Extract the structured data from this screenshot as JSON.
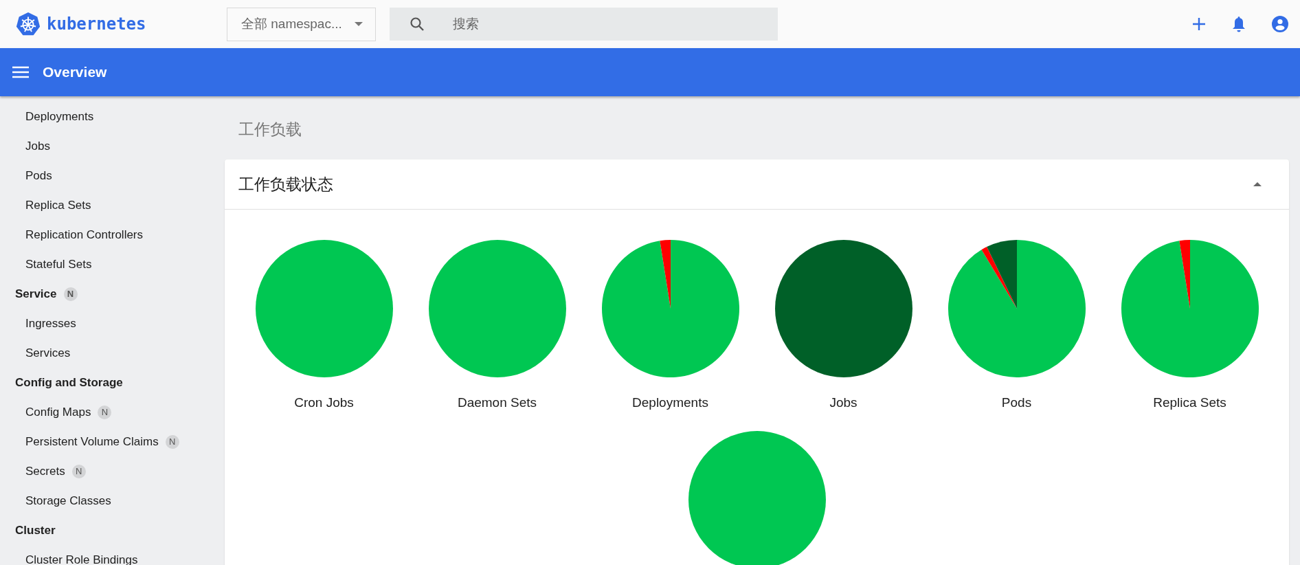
{
  "topbar": {
    "logo": "kubernetes",
    "namespace": "全部 namespac...",
    "search": {
      "placeholder": "搜索"
    }
  },
  "titlebar": {
    "title": "Overview"
  },
  "sidebar": {
    "items": [
      {
        "kind": "item",
        "label": "Deployments"
      },
      {
        "kind": "item",
        "label": "Jobs"
      },
      {
        "kind": "item",
        "label": "Pods"
      },
      {
        "kind": "item",
        "label": "Replica Sets"
      },
      {
        "kind": "item",
        "label": "Replication Controllers"
      },
      {
        "kind": "item",
        "label": "Stateful Sets"
      },
      {
        "kind": "header",
        "label": "Service",
        "badge": "N"
      },
      {
        "kind": "item",
        "label": "Ingresses"
      },
      {
        "kind": "item",
        "label": "Services"
      },
      {
        "kind": "header",
        "label": "Config and Storage"
      },
      {
        "kind": "item",
        "label": "Config Maps",
        "badge": "N"
      },
      {
        "kind": "item",
        "label": "Persistent Volume Claims",
        "badge": "N"
      },
      {
        "kind": "item",
        "label": "Secrets",
        "badge": "N"
      },
      {
        "kind": "item",
        "label": "Storage Classes"
      },
      {
        "kind": "header",
        "label": "Cluster"
      },
      {
        "kind": "item",
        "label": "Cluster Role Bindings"
      }
    ]
  },
  "content": {
    "heading": "工作负载",
    "card": {
      "title": "工作负载状态",
      "expanded": true,
      "charts": [
        {
          "kind": "running",
          "label": "Cron Jobs"
        },
        {
          "kind": "running",
          "label": "Daemon Sets"
        },
        {
          "kind": "few-failed",
          "label": "Deployments"
        },
        {
          "kind": "succeeded",
          "label": "Jobs"
        },
        {
          "kind": "mixed",
          "label": "Pods"
        },
        {
          "kind": "few-failed",
          "label": "Replica Sets"
        },
        {
          "kind": "running"
        }
      ]
    }
  }
}
